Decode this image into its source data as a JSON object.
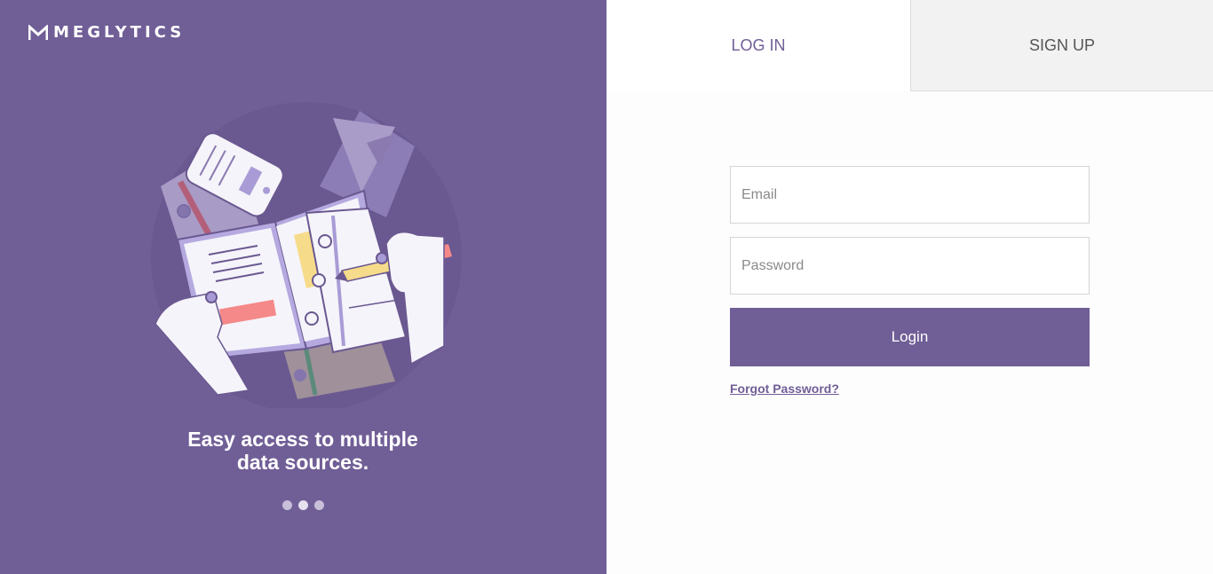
{
  "brand": {
    "name": "MEGLYTICS",
    "logo_icon": "m-logo-icon"
  },
  "hero": {
    "illustration": "workspace-illustration",
    "tagline_line1": "Easy access to multiple",
    "tagline_line2": "data sources.",
    "carousel": {
      "slide_count": 3,
      "active_index": 1
    }
  },
  "tabs": {
    "login": "LOG IN",
    "signup": "SIGN UP",
    "active": "login"
  },
  "form": {
    "email_placeholder": "Email",
    "password_placeholder": "Password",
    "submit_label": "Login",
    "forgot_link": "Forgot Password?"
  },
  "colors": {
    "brand_purple": "#705e96",
    "tab_inactive_bg": "#f2f2f2",
    "accent_yellow": "#f6dc8a",
    "accent_pink": "#f58888"
  }
}
